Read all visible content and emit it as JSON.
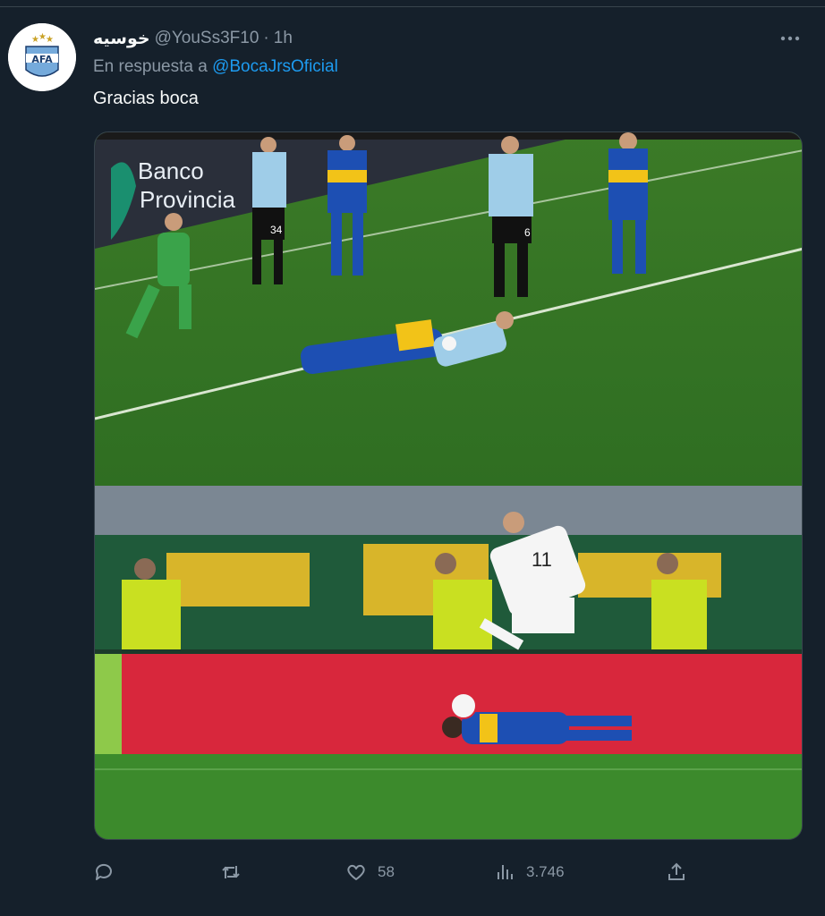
{
  "tweet": {
    "display_name": "خوسيه",
    "handle": "@YouSs3F10",
    "separator": "·",
    "time": "1h",
    "reply_prefix": "En respuesta a",
    "reply_to": "@BocaJrsOficial",
    "text": "Gracias boca"
  },
  "media": {
    "ad_text_line1": "Banco",
    "ad_text_line2": "Provincia",
    "shirt_numbers": [
      "34",
      "6",
      "11"
    ]
  },
  "actions": {
    "reply_count": "",
    "retweet_count": "",
    "like_count": "58",
    "views_count": "3.746"
  },
  "icons": [
    "afa-logo-icon",
    "more-icon",
    "reply-icon",
    "retweet-icon",
    "like-icon",
    "views-icon",
    "share-icon"
  ],
  "colors": {
    "background": "#15202b",
    "text_primary": "#f7f9f9",
    "text_secondary": "#8b98a5",
    "link": "#1d9bf0",
    "border": "#38444d"
  }
}
